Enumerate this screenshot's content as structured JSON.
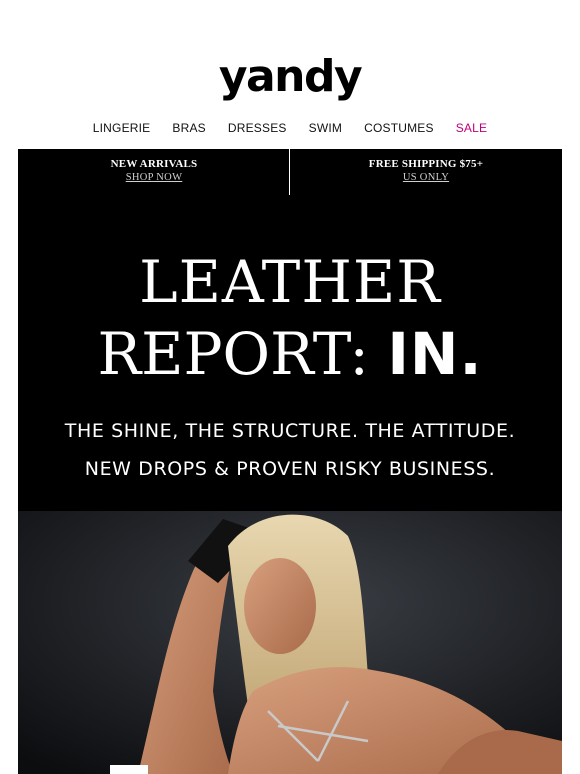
{
  "brand": {
    "logo": "yandy"
  },
  "nav": {
    "items": [
      "LINGERIE",
      "BRAS",
      "DRESSES",
      "SWIM",
      "COSTUMES",
      "SALE"
    ],
    "sale_color": "#c0007a"
  },
  "promo": {
    "left": {
      "title": "NEW ARRIVALS",
      "link": "SHOP NOW"
    },
    "right": {
      "title": "FREE SHIPPING $75+",
      "link": "US ONLY"
    }
  },
  "hero": {
    "headline_line1": "LEATHER",
    "headline_line2_a": "REPORT:",
    "headline_line2_b": "IN.",
    "sub_line1": "THE SHINE, THE STRUCTURE. THE ATTITUDE.",
    "sub_line2": "NEW DROPS & PROVEN RISKY BUSINESS.",
    "background_color": "#000000"
  }
}
